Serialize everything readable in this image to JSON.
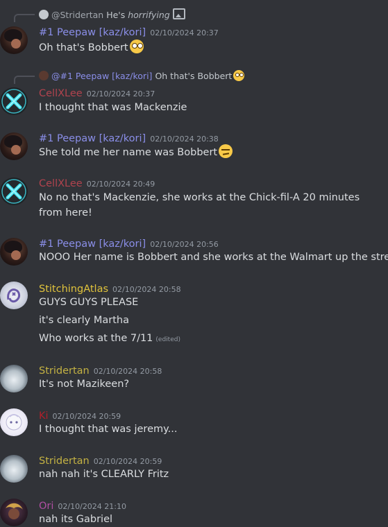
{
  "colors": {
    "background": "#313338",
    "peepaw": "#8a8ee8",
    "cellxlee": "#b1434e",
    "stitchingatlas": "#e0c33c",
    "stridertan": "#c4b243",
    "pink": "#b11f2a",
    "ori": "#b04fa3",
    "text": "#dbdee1",
    "timestamp": "#949ba4"
  },
  "messages": [
    {
      "id": "m1",
      "reply": {
        "icon": "reply-avatar-icon",
        "name": "@Stridertan",
        "text": "He's",
        "emph": "horrifying",
        "attachment_icon": "image-icon"
      },
      "author": "#1 Peepaw [kaz/kori]",
      "time": "02/10/2024 20:37",
      "lines": [
        "Oh that's Bobbert"
      ],
      "emoji": "flushed-emoji"
    },
    {
      "id": "m2",
      "reply": {
        "icon": "reply-avatar-icon",
        "name": "@#1 Peepaw [kaz/kori]",
        "text": "Oh that's Bobbert"
      },
      "author": "CellXLee",
      "time": "02/10/2024 20:37",
      "lines": [
        "I thought that was Mackenzie"
      ]
    },
    {
      "id": "m3",
      "author": "#1 Peepaw [kaz/kori]",
      "time": "02/10/2024 20:38",
      "lines": [
        "She told me her name was Bobbert"
      ],
      "emoji": "unamused-emoji"
    },
    {
      "id": "m4",
      "author": "CellXLee",
      "time": "02/10/2024 20:49",
      "lines": [
        "No no that's Mackenzie, she works at the Chick-fil-A 20 minutes from here!"
      ]
    },
    {
      "id": "m5",
      "author": "#1 Peepaw [kaz/kori]",
      "time": "02/10/2024 20:56",
      "lines": [
        "NOOO Her name is Bobbert and she works at the Walmart up the street!"
      ]
    },
    {
      "id": "m6",
      "author": "StitchingAtlas",
      "time": "02/10/2024 20:58",
      "lines": [
        "GUYS GUYS PLEASE",
        "it's clearly Martha",
        "Who works at the 7/11"
      ],
      "edited": "(edited)"
    },
    {
      "id": "m7",
      "author": "Stridertan",
      "time": "02/10/2024 20:58",
      "lines": [
        "It's not Mazikeen?"
      ]
    },
    {
      "id": "m8",
      "author": "Ki",
      "time": "02/10/2024 20:59",
      "lines": [
        "I thought that was jeremy..."
      ]
    },
    {
      "id": "m9",
      "author": "Stridertan",
      "time": "02/10/2024 20:59",
      "lines": [
        "nah nah it's CLEARLY Fritz"
      ]
    },
    {
      "id": "m10",
      "author": "Ori",
      "time": "02/10/2024 21:10",
      "lines": [
        "nah its Gabriel"
      ]
    }
  ]
}
